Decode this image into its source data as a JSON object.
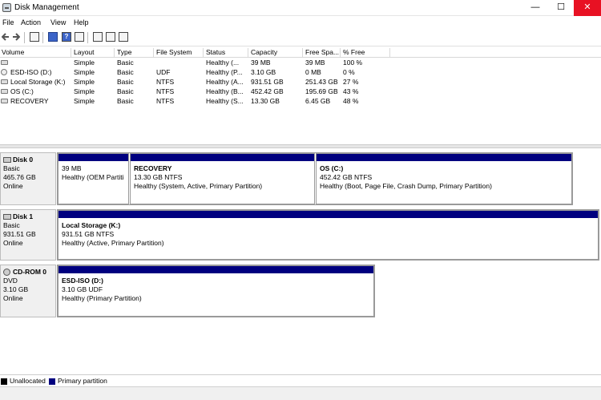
{
  "window": {
    "title": "Disk Management",
    "minimize": "—",
    "maximize": "☐",
    "close": "✕"
  },
  "menu": [
    "File",
    "Action",
    "View",
    "Help"
  ],
  "volumes": {
    "columns": [
      "Volume",
      "Layout",
      "Type",
      "File System",
      "Status",
      "Capacity",
      "Free Spa...",
      "% Free"
    ],
    "rows": [
      {
        "volume": "",
        "layout": "Simple",
        "type": "Basic",
        "fs": "",
        "status": "Healthy (...",
        "capacity": "39 MB",
        "free": "39 MB",
        "pct": "100 %"
      },
      {
        "volume": "ESD-ISO (D:)",
        "layout": "Simple",
        "type": "Basic",
        "fs": "UDF",
        "status": "Healthy (P...",
        "capacity": "3.10 GB",
        "free": "0 MB",
        "pct": "0 %"
      },
      {
        "volume": "Local Storage (K:)",
        "layout": "Simple",
        "type": "Basic",
        "fs": "NTFS",
        "status": "Healthy (A...",
        "capacity": "931.51 GB",
        "free": "251.43 GB",
        "pct": "27 %"
      },
      {
        "volume": "OS (C:)",
        "layout": "Simple",
        "type": "Basic",
        "fs": "NTFS",
        "status": "Healthy (B...",
        "capacity": "452.42 GB",
        "free": "195.69 GB",
        "pct": "43 %"
      },
      {
        "volume": "RECOVERY",
        "layout": "Simple",
        "type": "Basic",
        "fs": "NTFS",
        "status": "Healthy (S...",
        "capacity": "13.30 GB",
        "free": "6.45 GB",
        "pct": "48 %"
      }
    ]
  },
  "disks": [
    {
      "name": "Disk 0",
      "kind": "Basic",
      "size": "465.76 GB",
      "state": "Online",
      "partitions": [
        {
          "name": "",
          "size": "39 MB",
          "status": "Healthy (OEM Partiti"
        },
        {
          "name": "RECOVERY",
          "size": "13.30 GB NTFS",
          "status": "Healthy (System, Active, Primary Partition)"
        },
        {
          "name": "OS  (C:)",
          "size": "452.42 GB NTFS",
          "status": "Healthy (Boot, Page File, Crash Dump, Primary Partition)"
        }
      ]
    },
    {
      "name": "Disk 1",
      "kind": "Basic",
      "size": "931.51 GB",
      "state": "Online",
      "partitions": [
        {
          "name": "Local Storage  (K:)",
          "size": "931.51 GB NTFS",
          "status": "Healthy (Active, Primary Partition)"
        }
      ]
    },
    {
      "name": "CD-ROM 0",
      "kind": "DVD",
      "size": "3.10 GB",
      "state": "Online",
      "partitions": [
        {
          "name": "ESD-ISO  (D:)",
          "size": "3.10 GB UDF",
          "status": "Healthy (Primary Partition)"
        }
      ]
    }
  ],
  "legend": [
    {
      "label": "Unallocated",
      "color": "#000000"
    },
    {
      "label": "Primary partition",
      "color": "#00007f"
    }
  ]
}
